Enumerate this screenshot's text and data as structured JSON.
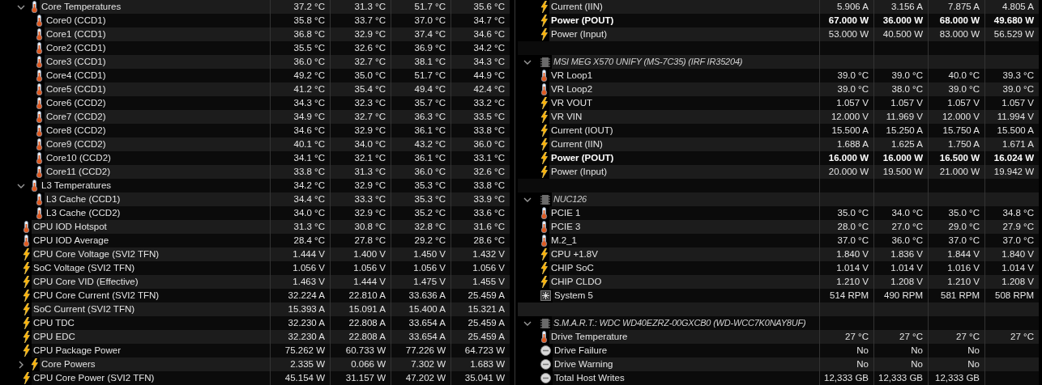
{
  "panels": [
    {
      "devices": [
        {
          "sensors": [
            {
              "label": "Core Temperatures",
              "kind": "temp",
              "bold": false,
              "expanded": true,
              "values": [
                "37.2 °C",
                "31.3 °C",
                "51.7 °C",
                "35.6 °C"
              ],
              "children": [
                {
                  "label": "Core0 (CCD1)",
                  "kind": "temp",
                  "bold": false,
                  "values": [
                    "35.8 °C",
                    "33.7 °C",
                    "37.0 °C",
                    "34.7 °C"
                  ]
                },
                {
                  "label": "Core1 (CCD1)",
                  "kind": "temp",
                  "bold": false,
                  "values": [
                    "36.8 °C",
                    "32.9 °C",
                    "37.4 °C",
                    "34.6 °C"
                  ]
                },
                {
                  "label": "Core2 (CCD1)",
                  "kind": "temp",
                  "bold": false,
                  "values": [
                    "35.5 °C",
                    "32.6 °C",
                    "36.9 °C",
                    "34.2 °C"
                  ]
                },
                {
                  "label": "Core3 (CCD1)",
                  "kind": "temp",
                  "bold": false,
                  "values": [
                    "36.0 °C",
                    "32.7 °C",
                    "38.1 °C",
                    "34.3 °C"
                  ]
                },
                {
                  "label": "Core4 (CCD1)",
                  "kind": "temp",
                  "bold": false,
                  "values": [
                    "49.2 °C",
                    "35.0 °C",
                    "51.7 °C",
                    "44.9 °C"
                  ]
                },
                {
                  "label": "Core5 (CCD1)",
                  "kind": "temp",
                  "bold": false,
                  "values": [
                    "41.2 °C",
                    "35.4 °C",
                    "49.4 °C",
                    "42.4 °C"
                  ]
                },
                {
                  "label": "Core6 (CCD2)",
                  "kind": "temp",
                  "bold": false,
                  "values": [
                    "34.3 °C",
                    "32.3 °C",
                    "35.7 °C",
                    "33.2 °C"
                  ]
                },
                {
                  "label": "Core7 (CCD2)",
                  "kind": "temp",
                  "bold": false,
                  "values": [
                    "34.9 °C",
                    "32.7 °C",
                    "36.3 °C",
                    "33.5 °C"
                  ]
                },
                {
                  "label": "Core8 (CCD2)",
                  "kind": "temp",
                  "bold": false,
                  "values": [
                    "34.6 °C",
                    "32.9 °C",
                    "36.1 °C",
                    "33.8 °C"
                  ]
                },
                {
                  "label": "Core9 (CCD2)",
                  "kind": "temp",
                  "bold": false,
                  "values": [
                    "40.1 °C",
                    "34.0 °C",
                    "43.2 °C",
                    "36.0 °C"
                  ]
                },
                {
                  "label": "Core10 (CCD2)",
                  "kind": "temp",
                  "bold": false,
                  "values": [
                    "34.1 °C",
                    "32.1 °C",
                    "36.1 °C",
                    "33.1 °C"
                  ]
                },
                {
                  "label": "Core11 (CCD2)",
                  "kind": "temp",
                  "bold": false,
                  "values": [
                    "33.8 °C",
                    "31.3 °C",
                    "36.0 °C",
                    "32.6 °C"
                  ]
                }
              ]
            },
            {
              "label": "L3 Temperatures",
              "kind": "temp",
              "bold": false,
              "expanded": true,
              "values": [
                "34.2 °C",
                "32.9 °C",
                "35.3 °C",
                "33.8 °C"
              ],
              "children": [
                {
                  "label": "L3 Cache (CCD1)",
                  "kind": "temp",
                  "bold": false,
                  "values": [
                    "34.4 °C",
                    "33.3 °C",
                    "35.3 °C",
                    "33.9 °C"
                  ]
                },
                {
                  "label": "L3 Cache (CCD2)",
                  "kind": "temp",
                  "bold": false,
                  "values": [
                    "34.0 °C",
                    "32.9 °C",
                    "35.2 °C",
                    "33.6 °C"
                  ]
                }
              ]
            },
            {
              "label": "CPU IOD Hotspot",
              "kind": "temp",
              "bold": false,
              "values": [
                "31.3 °C",
                "30.8 °C",
                "32.8 °C",
                "31.6 °C"
              ]
            },
            {
              "label": "CPU IOD Average",
              "kind": "temp",
              "bold": false,
              "values": [
                "28.4 °C",
                "27.8 °C",
                "29.2 °C",
                "28.6 °C"
              ]
            },
            {
              "label": "CPU Core Voltage (SVI2 TFN)",
              "kind": "power",
              "bold": false,
              "values": [
                "1.444 V",
                "1.400 V",
                "1.450 V",
                "1.432 V"
              ]
            },
            {
              "label": "SoC Voltage (SVI2 TFN)",
              "kind": "power",
              "bold": false,
              "values": [
                "1.056 V",
                "1.056 V",
                "1.056 V",
                "1.056 V"
              ]
            },
            {
              "label": "CPU Core VID (Effective)",
              "kind": "power",
              "bold": false,
              "values": [
                "1.463 V",
                "1.444 V",
                "1.475 V",
                "1.455 V"
              ]
            },
            {
              "label": "CPU Core Current (SVI2 TFN)",
              "kind": "power",
              "bold": false,
              "values": [
                "32.224 A",
                "22.810 A",
                "33.636 A",
                "25.459 A"
              ]
            },
            {
              "label": "SoC Current (SVI2 TFN)",
              "kind": "power",
              "bold": false,
              "values": [
                "15.393 A",
                "15.091 A",
                "15.400 A",
                "15.321 A"
              ]
            },
            {
              "label": "CPU TDC",
              "kind": "power",
              "bold": false,
              "values": [
                "32.230 A",
                "22.808 A",
                "33.654 A",
                "25.459 A"
              ]
            },
            {
              "label": "CPU EDC",
              "kind": "power",
              "bold": false,
              "values": [
                "32.230 A",
                "22.808 A",
                "33.654 A",
                "25.459 A"
              ]
            },
            {
              "label": "CPU Package Power",
              "kind": "power",
              "bold": false,
              "values": [
                "75.262 W",
                "60.733 W",
                "77.226 W",
                "64.723 W"
              ]
            },
            {
              "label": "Core Powers",
              "kind": "power",
              "bold": false,
              "expanded": false,
              "values": [
                "2.335 W",
                "0.066 W",
                "7.302 W",
                "1.683 W"
              ]
            },
            {
              "label": "CPU Core Power (SVI2 TFN)",
              "kind": "power",
              "bold": false,
              "values": [
                "45.154 W",
                "31.157 W",
                "47.202 W",
                "35.041 W"
              ]
            }
          ]
        }
      ]
    },
    {
      "devices": [
        {
          "sensors": [
            {
              "label": "Current (IIN)",
              "kind": "power",
              "bold": false,
              "values": [
                "5.906 A",
                "3.156 A",
                "7.875 A",
                "4.805 A"
              ]
            },
            {
              "label": "Power (POUT)",
              "kind": "power",
              "bold": true,
              "values": [
                "67.000 W",
                "36.000 W",
                "68.000 W",
                "49.680 W"
              ]
            },
            {
              "label": "Power (Input)",
              "kind": "power",
              "bold": false,
              "values": [
                "53.000 W",
                "40.500 W",
                "83.000 W",
                "56.529 W"
              ]
            }
          ]
        },
        {
          "title": "MSI MEG X570 UNIFY (MS-7C35) (IRF IR35204)",
          "expanded": true,
          "sensors": [
            {
              "label": "VR Loop1",
              "kind": "temp",
              "bold": false,
              "values": [
                "39.0 °C",
                "39.0 °C",
                "40.0 °C",
                "39.3 °C"
              ]
            },
            {
              "label": "VR Loop2",
              "kind": "temp",
              "bold": false,
              "values": [
                "39.0 °C",
                "38.0 °C",
                "39.0 °C",
                "39.0 °C"
              ]
            },
            {
              "label": "VR VOUT",
              "kind": "power",
              "bold": false,
              "values": [
                "1.057 V",
                "1.057 V",
                "1.057 V",
                "1.057 V"
              ]
            },
            {
              "label": "VR VIN",
              "kind": "power",
              "bold": false,
              "values": [
                "12.000 V",
                "11.969 V",
                "12.000 V",
                "11.994 V"
              ]
            },
            {
              "label": "Current (IOUT)",
              "kind": "power",
              "bold": false,
              "values": [
                "15.500 A",
                "15.250 A",
                "15.750 A",
                "15.500 A"
              ]
            },
            {
              "label": "Current (IIN)",
              "kind": "power",
              "bold": false,
              "values": [
                "1.688 A",
                "1.625 A",
                "1.750 A",
                "1.671 A"
              ]
            },
            {
              "label": "Power (POUT)",
              "kind": "power",
              "bold": true,
              "values": [
                "16.000 W",
                "16.000 W",
                "16.500 W",
                "16.024 W"
              ]
            },
            {
              "label": "Power (Input)",
              "kind": "power",
              "bold": false,
              "values": [
                "20.000 W",
                "19.500 W",
                "21.000 W",
                "19.942 W"
              ]
            }
          ]
        },
        {
          "title": "NUC126",
          "expanded": true,
          "sensors": [
            {
              "label": "PCIE 1",
              "kind": "temp",
              "bold": false,
              "values": [
                "35.0 °C",
                "34.0 °C",
                "35.0 °C",
                "34.8 °C"
              ]
            },
            {
              "label": "PCIE 3",
              "kind": "temp",
              "bold": false,
              "values": [
                "28.0 °C",
                "27.0 °C",
                "29.0 °C",
                "27.9 °C"
              ]
            },
            {
              "label": "M.2_1",
              "kind": "temp",
              "bold": false,
              "values": [
                "37.0 °C",
                "36.0 °C",
                "37.0 °C",
                "37.0 °C"
              ]
            },
            {
              "label": "CPU +1.8V",
              "kind": "power",
              "bold": false,
              "values": [
                "1.840 V",
                "1.836 V",
                "1.844 V",
                "1.840 V"
              ]
            },
            {
              "label": "CHIP SoC",
              "kind": "power",
              "bold": false,
              "values": [
                "1.014 V",
                "1.014 V",
                "1.016 V",
                "1.014 V"
              ]
            },
            {
              "label": "CHIP CLDO",
              "kind": "power",
              "bold": false,
              "values": [
                "1.210 V",
                "1.208 V",
                "1.210 V",
                "1.208 V"
              ]
            },
            {
              "label": "System 5",
              "kind": "fan",
              "bold": false,
              "values": [
                "514 RPM",
                "490 RPM",
                "581 RPM",
                "508 RPM"
              ]
            }
          ]
        },
        {
          "title": "S.M.A.R.T.: WDC WD40EZRZ-00GXCB0 (WD-WCC7K0NAY8UF)",
          "expanded": true,
          "sensors": [
            {
              "label": "Drive Temperature",
              "kind": "temp",
              "bold": false,
              "values": [
                "27 °C",
                "27 °C",
                "27 °C",
                "27 °C"
              ]
            },
            {
              "label": "Drive Failure",
              "kind": "status",
              "bold": false,
              "values": [
                "No",
                "No",
                "No"
              ]
            },
            {
              "label": "Drive Warning",
              "kind": "status",
              "bold": false,
              "values": [
                "No",
                "No",
                "No"
              ]
            },
            {
              "label": "Total Host Writes",
              "kind": "status",
              "bold": false,
              "values": [
                "12,333 GB",
                "12,333 GB",
                "12,333 GB"
              ]
            }
          ]
        }
      ]
    }
  ]
}
